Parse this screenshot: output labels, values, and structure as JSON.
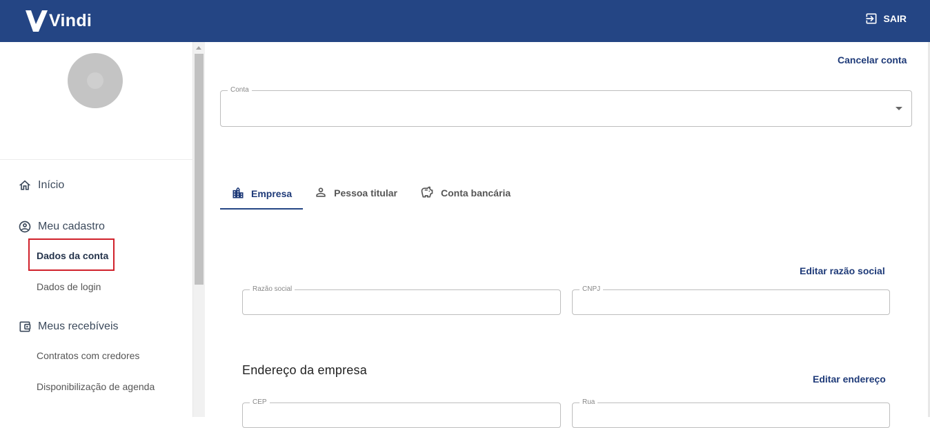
{
  "header": {
    "logo_text": "Vindi",
    "logout_label": "SAIR"
  },
  "sidebar": {
    "items": [
      {
        "label": "Início",
        "icon": "home-icon"
      },
      {
        "label": "Meu cadastro",
        "icon": "account-circle-icon",
        "children": [
          "Dados da conta",
          "Dados de login"
        ]
      },
      {
        "label": "Meus recebíveis",
        "icon": "wallet-icon",
        "children": [
          "Contratos com credores",
          "Disponibilização de agenda"
        ]
      }
    ],
    "active_item": "Dados da conta"
  },
  "main": {
    "cancel_account_label": "Cancelar conta",
    "account_select": {
      "label": "Conta",
      "value": ""
    },
    "tabs": [
      {
        "label": "Empresa",
        "icon": "building-icon",
        "active": true
      },
      {
        "label": "Pessoa titular",
        "icon": "person-icon",
        "active": false
      },
      {
        "label": "Conta bancária",
        "icon": "piggy-bank-icon",
        "active": false
      }
    ],
    "edit_company_name_label": "Editar razão social",
    "company_fields": [
      {
        "label": "Razão social",
        "value": ""
      },
      {
        "label": "CNPJ",
        "value": ""
      }
    ],
    "address_section_title": "Endereço da empresa",
    "edit_address_label": "Editar endereço",
    "address_fields": [
      {
        "label": "CEP",
        "value": ""
      },
      {
        "label": "Rua",
        "value": ""
      }
    ]
  },
  "colors": {
    "header_bg": "#244584",
    "accent": "#1e3a78",
    "active_highlight": "#d0202a"
  }
}
